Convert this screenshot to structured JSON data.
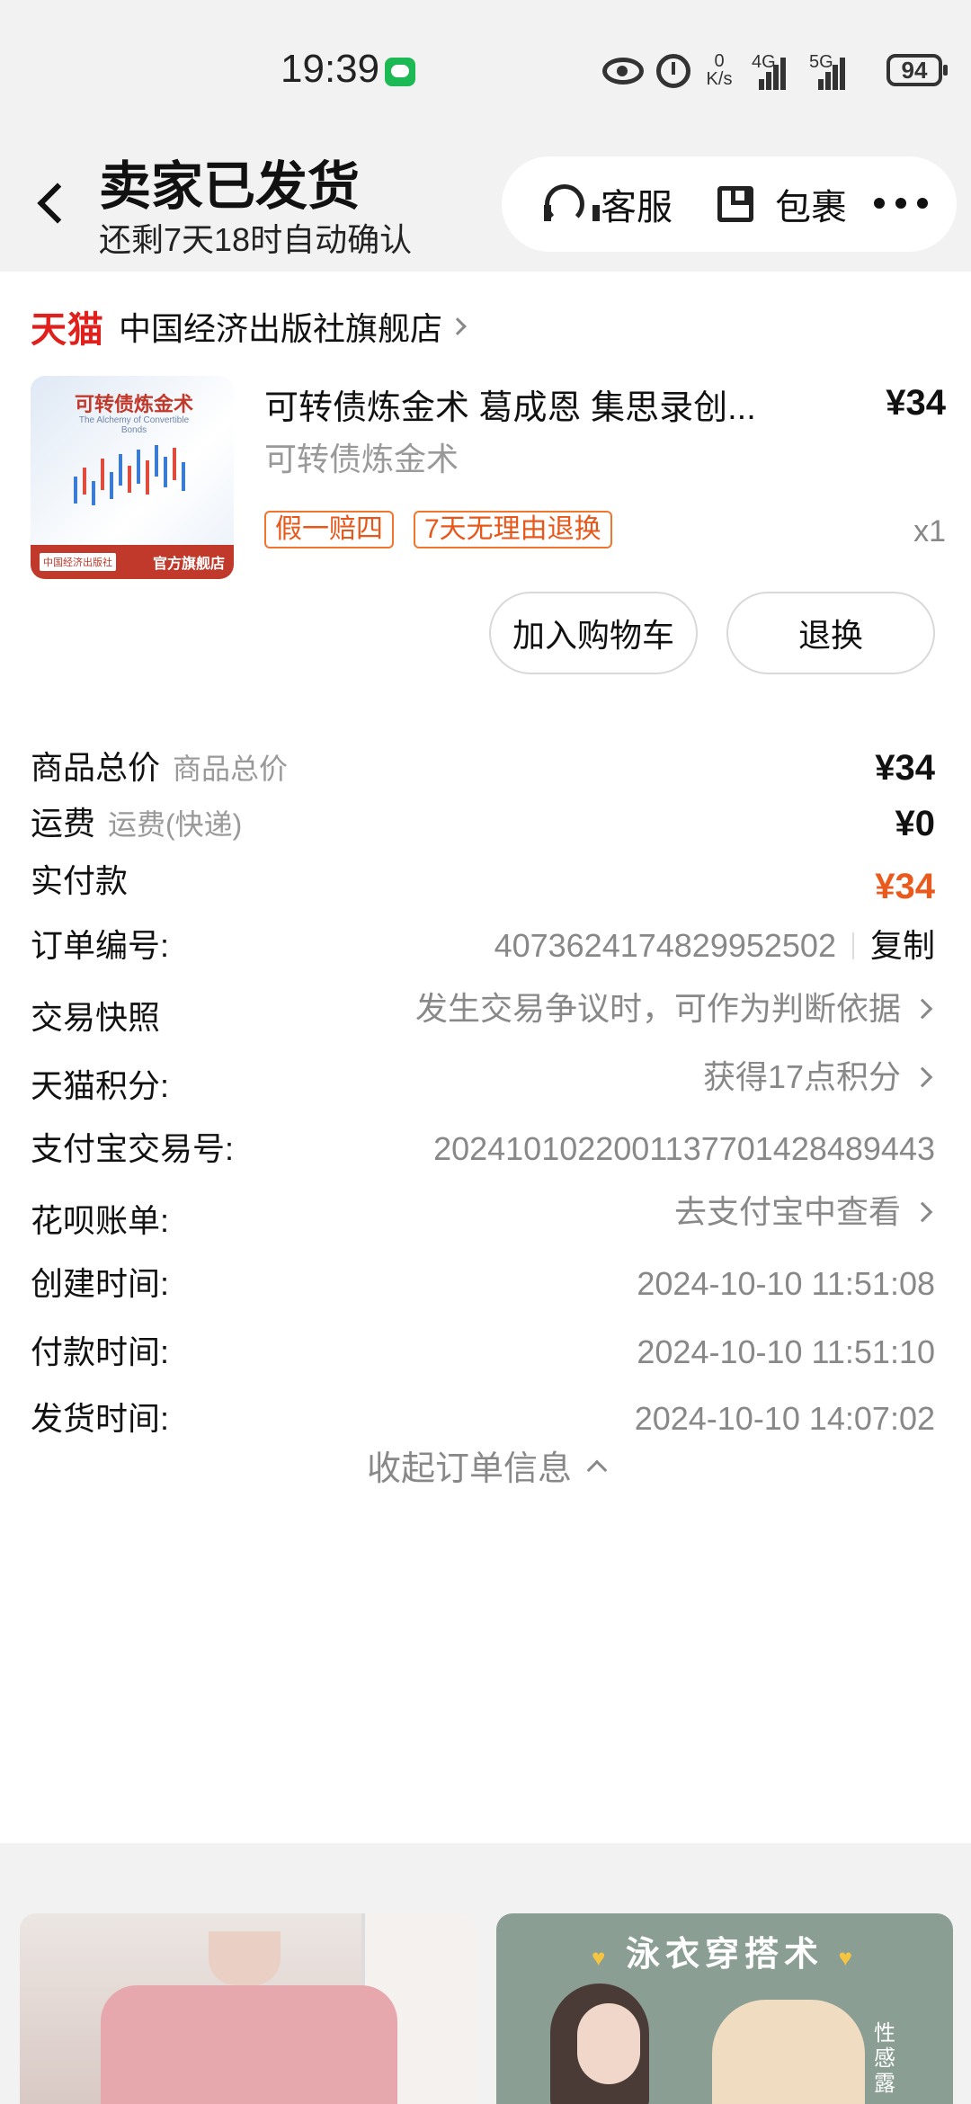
{
  "status_bar": {
    "time": "19:39",
    "net_speed_value": "0",
    "net_speed_unit": "K/s",
    "net1": "4G",
    "net2": "5G",
    "battery": "94",
    "icons": [
      "wechat-icon",
      "eye-icon",
      "alarm-icon",
      "signal-icon",
      "battery-icon"
    ]
  },
  "header": {
    "title": "卖家已发货",
    "subtitle": "还剩7天18时自动确认",
    "service_label": "客服",
    "package_label": "包裹"
  },
  "store": {
    "brand": "天猫",
    "name": "中国经济出版社旗舰店"
  },
  "product": {
    "title": "可转债炼金术 葛成恩 集思录创...",
    "spec": "可转债炼金术",
    "price": "¥34",
    "qty": "x1",
    "tags": [
      "假一赔四",
      "7天无理由退换"
    ],
    "cover": {
      "title": "可转债炼金术",
      "subtitle": "The Alchemy of Convertible Bonds",
      "publisher": "中国经济出版社",
      "badge": "官方旗舰店"
    }
  },
  "actions": {
    "add_cart": "加入购物车",
    "return": "退换"
  },
  "summary": {
    "total_label": "商品总价",
    "total_hint": "商品总价",
    "total_value": "¥34",
    "shipping_label": "运费",
    "shipping_hint": "运费(快递)",
    "shipping_value": "¥0",
    "paid_label": "实付款",
    "paid_value": "¥34"
  },
  "order_info": {
    "order_no_label": "订单编号:",
    "order_no": "4073624174829952502",
    "copy_label": "复制",
    "snapshot_label": "交易快照",
    "snapshot_value": "发生交易争议时，可作为判断依据",
    "points_label": "天猫积分:",
    "points_value": "获得17点积分",
    "alipay_label": "支付宝交易号:",
    "alipay_value": "2024101022001137701428489443",
    "huabei_label": "花呗账单:",
    "huabei_value": "去支付宝中查看",
    "created_label": "创建时间:",
    "created_value": "2024-10-10 11:51:08",
    "paid_time_label": "付款时间:",
    "paid_time_value": "2024-10-10 11:51:10",
    "shipped_label": "发货时间:",
    "shipped_value": "2024-10-10 14:07:02",
    "collapse_label": "收起订单信息"
  },
  "recommendations": {
    "right_title": "泳衣穿搭术",
    "right_side_text": "性感露"
  },
  "colors": {
    "accent": "#ea5a1c",
    "tmall_red": "#e0201d",
    "tag_orange": "#f0762d"
  }
}
